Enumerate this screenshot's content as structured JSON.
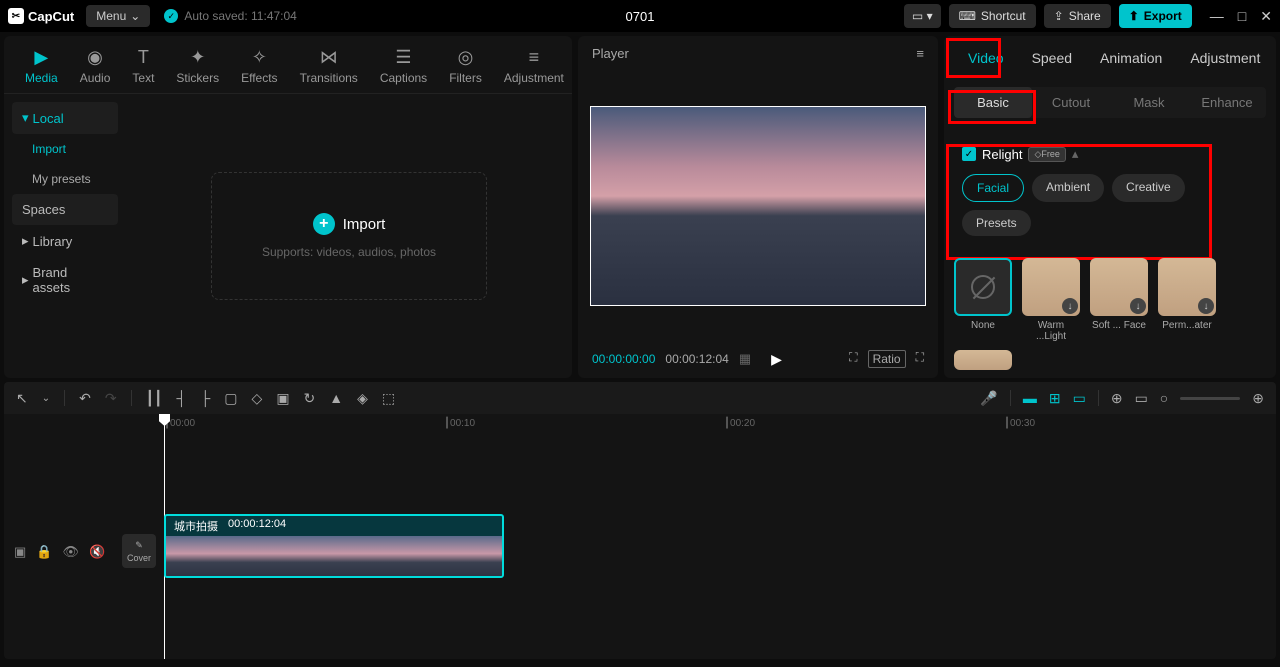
{
  "titlebar": {
    "app_name": "CapCut",
    "menu_label": "Menu",
    "autosave_text": "Auto saved: 11:47:04",
    "project_title": "0701",
    "shortcut_label": "Shortcut",
    "share_label": "Share",
    "export_label": "Export"
  },
  "media_tabs": [
    {
      "label": "Media",
      "active": true
    },
    {
      "label": "Audio"
    },
    {
      "label": "Text"
    },
    {
      "label": "Stickers"
    },
    {
      "label": "Effects"
    },
    {
      "label": "Transitions"
    },
    {
      "label": "Captions"
    },
    {
      "label": "Filters"
    },
    {
      "label": "Adjustment"
    }
  ],
  "sidebar": {
    "local": "Local",
    "import": "Import",
    "my_presets": "My presets",
    "spaces": "Spaces",
    "library": "Library",
    "brand_assets": "Brand assets"
  },
  "import_area": {
    "button_label": "Import",
    "hint": "Supports: videos, audios, photos"
  },
  "player": {
    "title": "Player",
    "current_time": "00:00:00:00",
    "duration": "00:00:12:04",
    "ratio_label": "Ratio"
  },
  "right_tabs": [
    {
      "label": "Video",
      "active": true
    },
    {
      "label": "Speed"
    },
    {
      "label": "Animation"
    },
    {
      "label": "Adjustment"
    }
  ],
  "right_subtabs": [
    {
      "label": "Basic",
      "active": true
    },
    {
      "label": "Cutout"
    },
    {
      "label": "Mask"
    },
    {
      "label": "Enhance"
    }
  ],
  "relight": {
    "title": "Relight",
    "badge": "Free",
    "pills": [
      {
        "label": "Facial",
        "active": true
      },
      {
        "label": "Ambient"
      },
      {
        "label": "Creative"
      },
      {
        "label": "Presets"
      }
    ],
    "presets": [
      {
        "label": "None",
        "active": true,
        "type": "none"
      },
      {
        "label": "Warm ...Light",
        "type": "face"
      },
      {
        "label": "Soft ... Face",
        "type": "face"
      },
      {
        "label": "Perm...ater",
        "type": "face"
      }
    ]
  },
  "cover_label": "Cover",
  "clip": {
    "name": "城市拍摄",
    "duration": "00:00:12:04"
  },
  "ruler": [
    "00:00",
    "00:10",
    "00:20",
    "00:30"
  ]
}
